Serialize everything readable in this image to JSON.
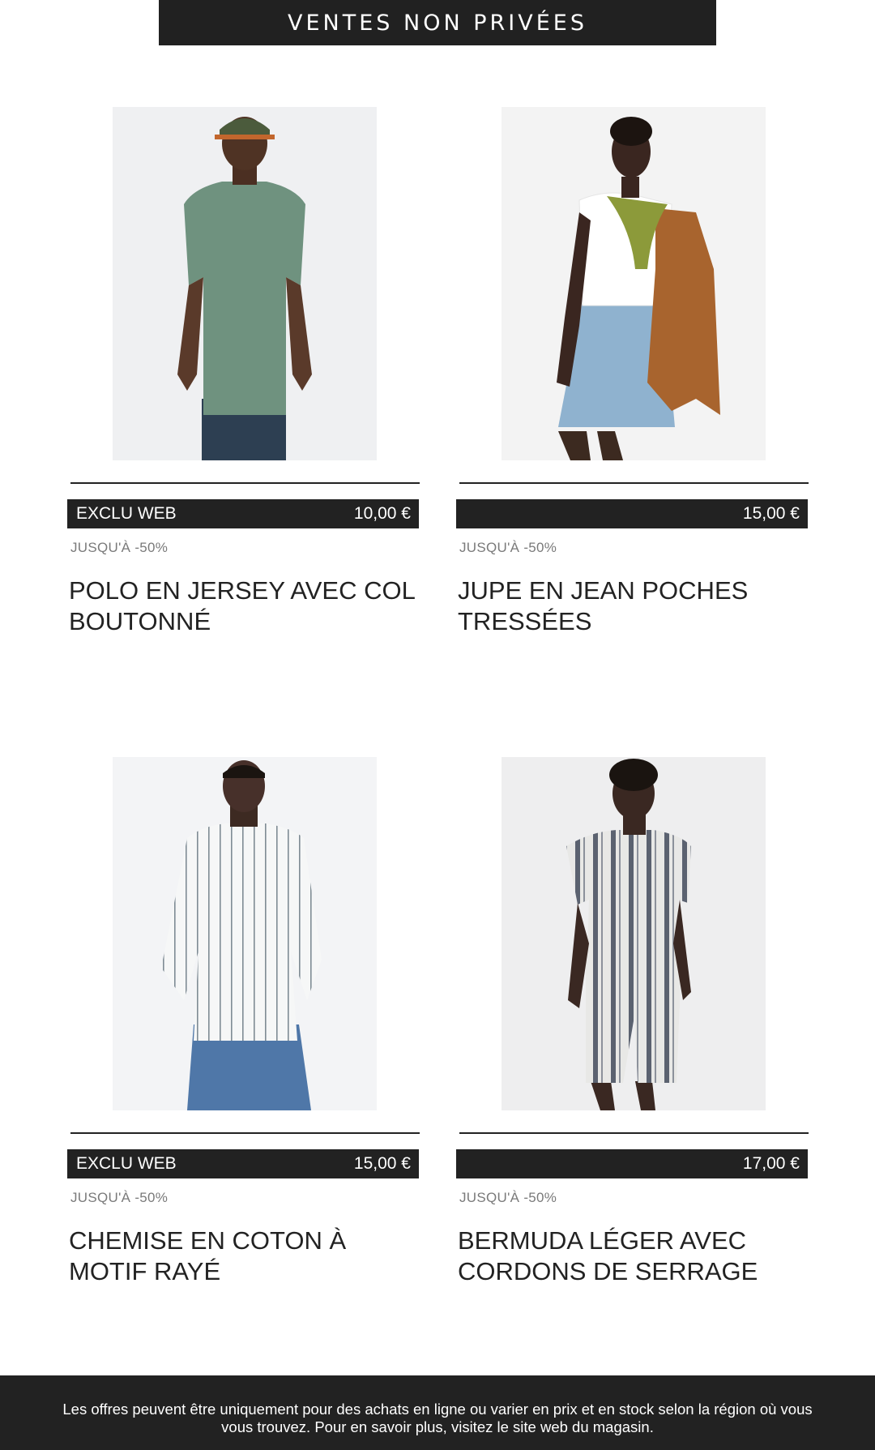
{
  "header": {
    "banner_text": "VENTES NON PRIVÉES"
  },
  "products": [
    {
      "badge": "EXCLU WEB",
      "price": "10,00 €",
      "discount": "JUSQU'À -50%",
      "title": "POLO EN JERSEY AVEC COL BOUTONNÉ",
      "image": "man-green-polo-photo"
    },
    {
      "badge": "",
      "price": "15,00 €",
      "discount": "JUSQU'À -50%",
      "title": "JUPE EN JEAN POCHES TRESSÉES",
      "image": "woman-denim-skirt-photo"
    },
    {
      "badge": "EXCLU WEB",
      "price": "15,00 €",
      "discount": "JUSQU'À -50%",
      "title": "CHEMISE EN COTON À MOTIF RAYÉ",
      "image": "man-striped-shirt-photo"
    },
    {
      "badge": "",
      "price": "17,00 €",
      "discount": "JUSQU'À -50%",
      "title": "BERMUDA LÉGER AVEC CORDONS DE SERRAGE",
      "image": "man-striped-bermuda-photo"
    }
  ],
  "footer": {
    "disclaimer": "Les offres peuvent être uniquement pour des achats en ligne ou varier en prix et en stock selon la région où vous vous trouvez. Pour en savoir plus, visitez le site web du magasin."
  },
  "colors": {
    "dark": "#222222",
    "discount_text": "#7a7a7a",
    "photo_bg": "#f1f2f4"
  }
}
